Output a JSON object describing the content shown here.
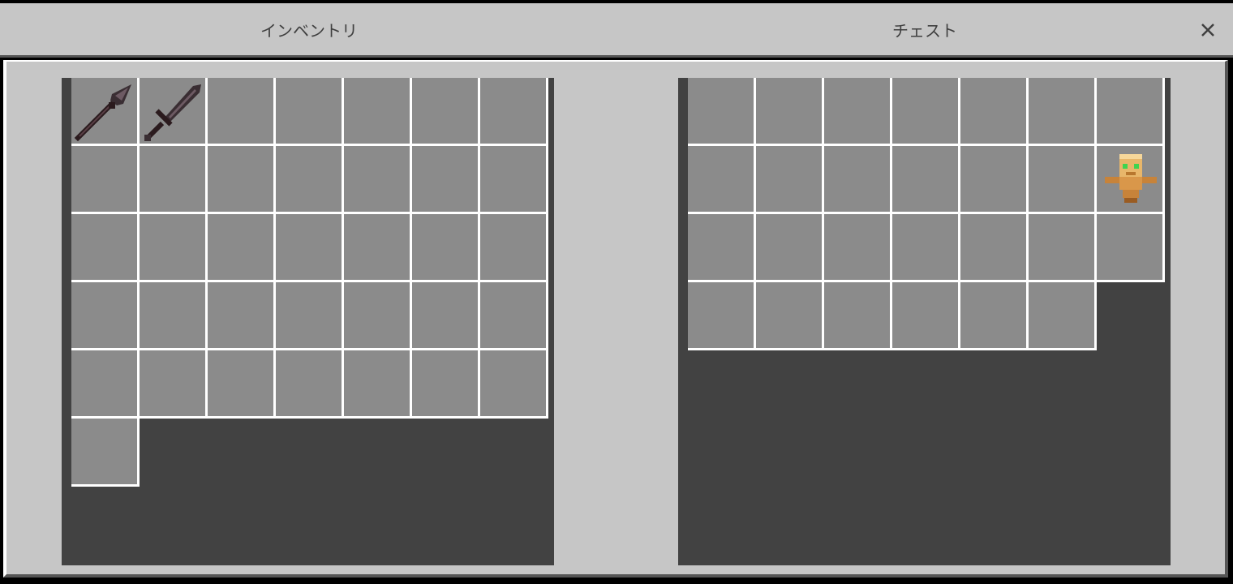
{
  "tabs": {
    "inventory": "インベントリ",
    "chest": "チェスト"
  },
  "icons": {
    "close": "close-icon",
    "spear": "spear-icon",
    "sword": "sword-icon",
    "totem": "totem-icon"
  },
  "colors": {
    "panel": "#c6c6c6",
    "container": "#424242",
    "slot": "#8b8b8b",
    "slot_border": "#ffffff"
  },
  "inventory": {
    "columns": 7,
    "slot_count": 36,
    "items": [
      {
        "slot": 0,
        "item": "spear"
      },
      {
        "slot": 1,
        "item": "sword"
      }
    ]
  },
  "chest": {
    "columns": 7,
    "slot_count": 27,
    "items": [
      {
        "slot": 13,
        "item": "totem"
      }
    ]
  }
}
